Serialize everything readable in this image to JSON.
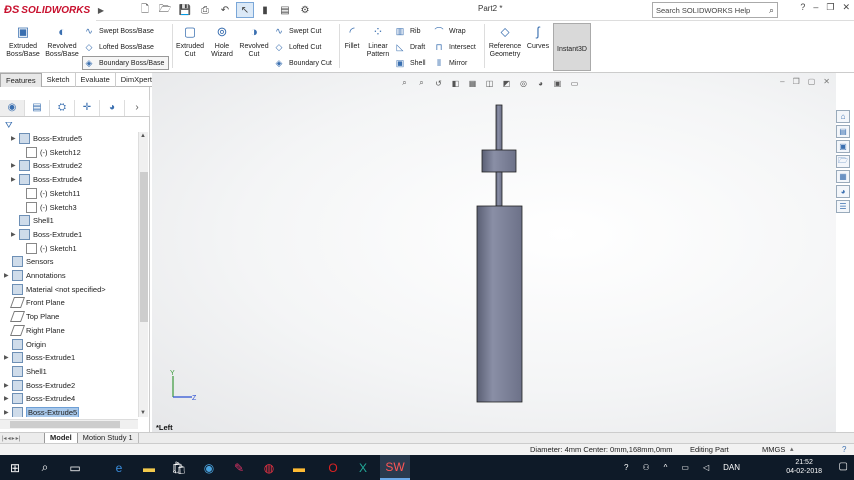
{
  "app": {
    "logo": "SOLIDWORKS",
    "doc_title": "Part2 *"
  },
  "search": {
    "placeholder": "Search SOLIDWORKS Help"
  },
  "ribbon": {
    "extruded_boss": "Extruded Boss/Base",
    "revolved_boss": "Revolved Boss/Base",
    "swept_boss": "Swept Boss/Base",
    "lofted_boss": "Lofted Boss/Base",
    "boundary_boss": "Boundary Boss/Base",
    "extruded_cut": "Extruded Cut",
    "hole_wizard": "Hole Wizard",
    "revolved_cut": "Revolved Cut",
    "swept_cut": "Swept Cut",
    "lofted_cut": "Lofted Cut",
    "boundary_cut": "Boundary Cut",
    "fillet": "Fillet",
    "linear_pattern": "Linear Pattern",
    "rib": "Rib",
    "draft": "Draft",
    "shell": "Shell",
    "wrap": "Wrap",
    "intersect": "Intersect",
    "mirror": "Mirror",
    "reference_geometry": "Reference Geometry",
    "curves": "Curves",
    "instant3d": "Instant3D"
  },
  "tabs": [
    "Features",
    "Sketch",
    "Evaluate",
    "DimXpert"
  ],
  "tree": [
    {
      "label": "Boss-Extrude5",
      "type": "feature",
      "level": 1,
      "expandable": true
    },
    {
      "label": "(-) Sketch12",
      "type": "sketch",
      "level": 2
    },
    {
      "label": "Boss-Extrude2",
      "type": "feature",
      "level": 1,
      "expandable": true
    },
    {
      "label": "Boss-Extrude4",
      "type": "feature",
      "level": 1,
      "expandable": true
    },
    {
      "label": "(-) Sketch11",
      "type": "sketch",
      "level": 2
    },
    {
      "label": "(-) Sketch3",
      "type": "sketch",
      "level": 2
    },
    {
      "label": "Shell1",
      "type": "feature",
      "level": 1
    },
    {
      "label": "Boss-Extrude1",
      "type": "feature",
      "level": 1,
      "expandable": true
    },
    {
      "label": "(-) Sketch1",
      "type": "sketch",
      "level": 2
    },
    {
      "label": "Sensors",
      "type": "folder",
      "level": 0
    },
    {
      "label": "Annotations",
      "type": "folder",
      "level": 0,
      "expandable": true
    },
    {
      "label": "Material <not specified>",
      "type": "material",
      "level": 0
    },
    {
      "label": "Front Plane",
      "type": "plane",
      "level": 0
    },
    {
      "label": "Top Plane",
      "type": "plane",
      "level": 0
    },
    {
      "label": "Right Plane",
      "type": "plane",
      "level": 0
    },
    {
      "label": "Origin",
      "type": "origin",
      "level": 0
    },
    {
      "label": "Boss-Extrude1",
      "type": "feature",
      "level": 0,
      "expandable": true
    },
    {
      "label": "Shell1",
      "type": "feature",
      "level": 0
    },
    {
      "label": "Boss-Extrude2",
      "type": "feature",
      "level": 0,
      "expandable": true
    },
    {
      "label": "Boss-Extrude4",
      "type": "feature",
      "level": 0,
      "expandable": true
    },
    {
      "label": "Boss-Extrude5",
      "type": "feature",
      "level": 0,
      "expandable": true,
      "selected": true
    }
  ],
  "viewport": {
    "view_label": "*Left",
    "triad_y": "Y",
    "triad_z": "Z"
  },
  "bottom_tabs": [
    "Model",
    "Motion Study 1"
  ],
  "status": {
    "measure": "Diameter: 4mm  Center: 0mm,168mm,0mm",
    "mode": "Editing Part",
    "units": "MMGS"
  },
  "taskbar": {
    "language": "DAN",
    "time": "21:52",
    "date": "04-02-2018"
  },
  "colors": {
    "accent": "#c8102e",
    "selection": "#a8c8ea",
    "model": "#7a7f96"
  }
}
